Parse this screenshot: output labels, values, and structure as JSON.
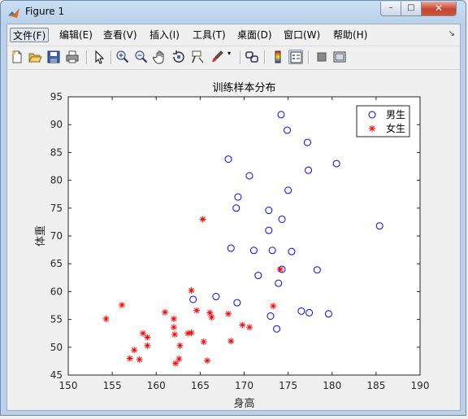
{
  "window": {
    "title": "Figure 1",
    "minimize_label": "–",
    "maximize_label": "□",
    "close_label": "✕"
  },
  "menubar": {
    "items": [
      {
        "label": "文件(F)"
      },
      {
        "label": "编辑(E)"
      },
      {
        "label": "查看(V)"
      },
      {
        "label": "插入(I)"
      },
      {
        "label": "工具(T)"
      },
      {
        "label": "桌面(D)"
      },
      {
        "label": "窗口(W)"
      },
      {
        "label": "帮助(H)"
      }
    ],
    "overflow_label": "↘"
  },
  "toolbar": {
    "icons": [
      "new-figure-icon",
      "open-file-icon",
      "save-icon",
      "print-icon",
      "pointer-icon",
      "zoom-in-icon",
      "zoom-out-icon",
      "pan-icon",
      "rotate-3d-icon",
      "data-cursor-icon",
      "brush-icon",
      "link-plot-icon",
      "colorbar-icon",
      "legend-icon",
      "hide-plot-tools-icon",
      "show-plot-tools-icon"
    ]
  },
  "chart_data": {
    "type": "scatter",
    "title": "训练样本分布",
    "xlabel": "身高",
    "ylabel": "体重",
    "xlim": [
      150,
      190
    ],
    "ylim": [
      45,
      95
    ],
    "xticks": [
      150,
      155,
      160,
      165,
      170,
      175,
      180,
      185,
      190
    ],
    "yticks": [
      45,
      50,
      55,
      60,
      65,
      70,
      75,
      80,
      85,
      90,
      95
    ],
    "legend_position": "top-right",
    "grid": false,
    "series": [
      {
        "name": "男生",
        "marker": "circle",
        "color": "#0000ff",
        "points": [
          [
            174.2,
            91.8
          ],
          [
            174.9,
            89.0
          ],
          [
            177.2,
            86.8
          ],
          [
            168.2,
            83.8
          ],
          [
            180.5,
            83.0
          ],
          [
            177.3,
            81.8
          ],
          [
            170.6,
            80.8
          ],
          [
            175.0,
            78.2
          ],
          [
            169.3,
            77.0
          ],
          [
            169.1,
            75.0
          ],
          [
            172.8,
            74.6
          ],
          [
            174.3,
            73.0
          ],
          [
            185.4,
            71.8
          ],
          [
            172.8,
            71.0
          ],
          [
            168.5,
            67.8
          ],
          [
            171.1,
            67.4
          ],
          [
            173.2,
            67.4
          ],
          [
            175.4,
            67.2
          ],
          [
            174.3,
            64.0
          ],
          [
            178.3,
            63.9
          ],
          [
            171.6,
            62.9
          ],
          [
            173.9,
            61.5
          ],
          [
            166.8,
            59.1
          ],
          [
            164.2,
            58.6
          ],
          [
            169.2,
            58.0
          ],
          [
            176.5,
            56.5
          ],
          [
            177.4,
            56.2
          ],
          [
            179.6,
            56.0
          ],
          [
            173.0,
            55.6
          ],
          [
            173.7,
            53.3
          ]
        ]
      },
      {
        "name": "女生",
        "marker": "asterisk",
        "color": "#ff0000",
        "points": [
          [
            165.3,
            73.0
          ],
          [
            174.1,
            64.0
          ],
          [
            164.0,
            60.2
          ],
          [
            156.1,
            57.6
          ],
          [
            173.3,
            57.4
          ],
          [
            161.0,
            56.3
          ],
          [
            164.6,
            56.6
          ],
          [
            166.1,
            56.2
          ],
          [
            168.2,
            56.0
          ],
          [
            166.3,
            55.4
          ],
          [
            162.0,
            55.1
          ],
          [
            154.3,
            55.1
          ],
          [
            169.8,
            54.0
          ],
          [
            170.6,
            53.6
          ],
          [
            162.0,
            53.6
          ],
          [
            158.5,
            52.5
          ],
          [
            163.6,
            52.5
          ],
          [
            164.0,
            52.6
          ],
          [
            159.0,
            51.8
          ],
          [
            162.1,
            52.3
          ],
          [
            165.4,
            51.0
          ],
          [
            168.5,
            51.1
          ],
          [
            159.0,
            50.3
          ],
          [
            162.7,
            50.3
          ],
          [
            157.5,
            49.5
          ],
          [
            158.1,
            47.8
          ],
          [
            157.0,
            48.0
          ],
          [
            162.6,
            47.9
          ],
          [
            165.8,
            47.6
          ],
          [
            162.2,
            47.1
          ]
        ]
      }
    ]
  }
}
